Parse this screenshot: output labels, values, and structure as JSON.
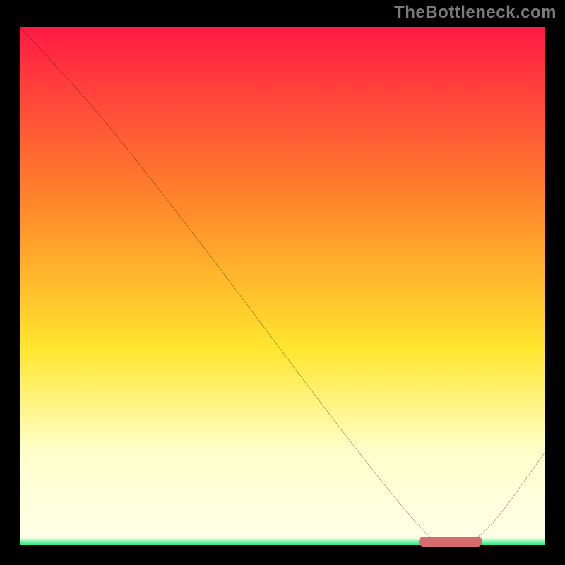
{
  "attribution": "TheBottleneck.com",
  "colors": {
    "red": "#ff1a44",
    "orange": "#ff8a2a",
    "yellow": "#ffe62e",
    "pale_yellow": "#ffffcc",
    "green": "#17e67a",
    "marker": "#d66b6f",
    "curve": "#000000",
    "frame": "#000000"
  },
  "chart_data": {
    "type": "line",
    "title": "",
    "xlabel": "",
    "ylabel": "",
    "xlim": [
      0,
      100
    ],
    "ylim": [
      0,
      100
    ],
    "x": [
      0,
      20,
      76,
      82,
      88,
      100
    ],
    "values": [
      100,
      78,
      2,
      0,
      1,
      18
    ],
    "optimal_band": {
      "x_start": 76,
      "x_end": 88,
      "y": 0.7
    },
    "gradient_stops": [
      {
        "pos": 0.0,
        "color": "#ff1a44"
      },
      {
        "pos": 0.35,
        "color": "#ff8a2a"
      },
      {
        "pos": 0.62,
        "color": "#ffe62e"
      },
      {
        "pos": 0.82,
        "color": "#ffffcc"
      },
      {
        "pos": 0.985,
        "color": "#ffffe8"
      },
      {
        "pos": 1.0,
        "color": "#17e67a"
      }
    ]
  }
}
